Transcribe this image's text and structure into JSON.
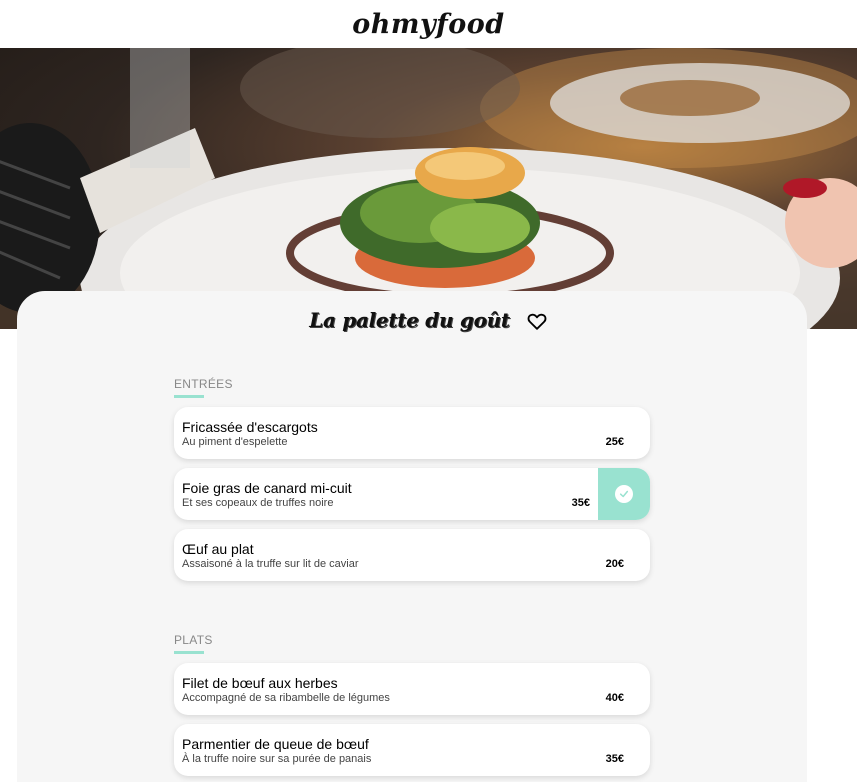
{
  "header": {
    "logo": "ohmyfood"
  },
  "restaurant": {
    "name": "La palette du goût",
    "favorite_icon": "heart-outline-icon"
  },
  "colors": {
    "accent": "#99e2d0",
    "panel": "#f6f6f6"
  },
  "sections": [
    {
      "title": "ENTRÉES",
      "items": [
        {
          "name": "Fricassée d'escargots",
          "description": "Au piment d'espelette",
          "price": "25€",
          "selected": false
        },
        {
          "name": "Foie gras de canard mi-cuit",
          "description": "Et ses copeaux de truffes noire",
          "price": "35€",
          "selected": true
        },
        {
          "name": "Œuf au plat",
          "description": "Assaisoné à la truffe sur lit de caviar",
          "price": "20€",
          "selected": false
        }
      ]
    },
    {
      "title": "PLATS",
      "items": [
        {
          "name": "Filet de bœuf aux herbes",
          "description": "Accompagné de sa ribambelle de légumes",
          "price": "40€",
          "selected": false
        },
        {
          "name": "Parmentier de queue de bœuf",
          "description": "À la truffe noire sur sa purée de panais",
          "price": "35€",
          "selected": false
        }
      ]
    }
  ]
}
